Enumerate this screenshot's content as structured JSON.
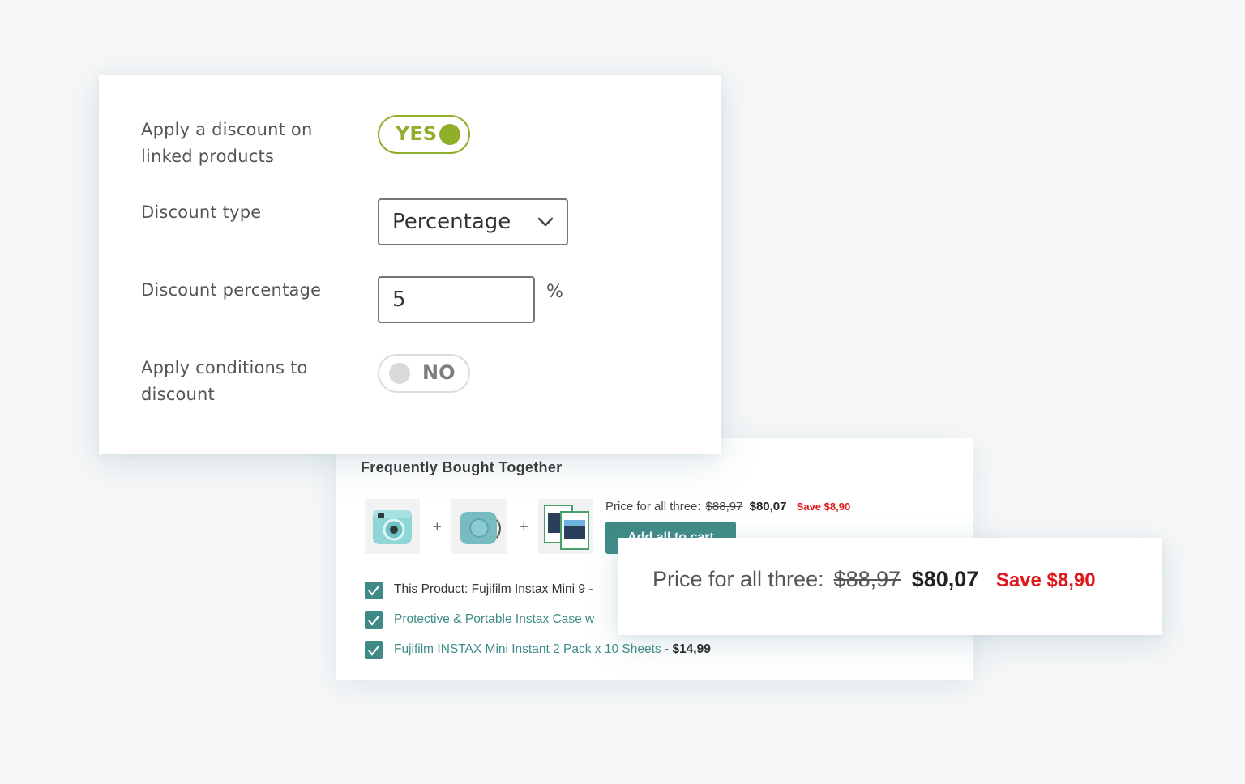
{
  "settings": {
    "apply_discount_label": "Apply a discount on linked products",
    "apply_discount_toggle": "YES",
    "discount_type_label": "Discount type",
    "discount_type_value": "Percentage",
    "discount_percentage_label": "Discount percentage",
    "discount_percentage_value": "5",
    "percent_symbol": "%",
    "apply_conditions_label": "Apply conditions to discount",
    "apply_conditions_toggle": "NO",
    "accent_color": "#8fae2b"
  },
  "fbt": {
    "title": "Frequently Bought Together",
    "plus": "+",
    "price_label": "Price for all three:",
    "old_price": "$88,97",
    "new_price": "$80,07",
    "save_text": "Save $8,90",
    "add_to_cart": "Add all to cart",
    "accent_color": "#3f8a86",
    "items": [
      {
        "label": "This Product: Fujifilm Instax Mini 9 -",
        "checked": true
      },
      {
        "label": "Protective & Portable Instax Case w",
        "checked": true
      },
      {
        "label": "Fujifilm INSTAX Mini Instant 2 Pack x 10 Sheets",
        "separator": "-",
        "price": "$14,99",
        "checked": true
      }
    ],
    "thumbnails": [
      "camera-icon",
      "camera-case-icon",
      "film-pack-icon"
    ]
  },
  "zoom": {
    "price_label": "Price for all three:",
    "old_price": "$88,97",
    "new_price": "$80,07",
    "save_text": "Save $8,90",
    "save_color": "#e0161b"
  }
}
